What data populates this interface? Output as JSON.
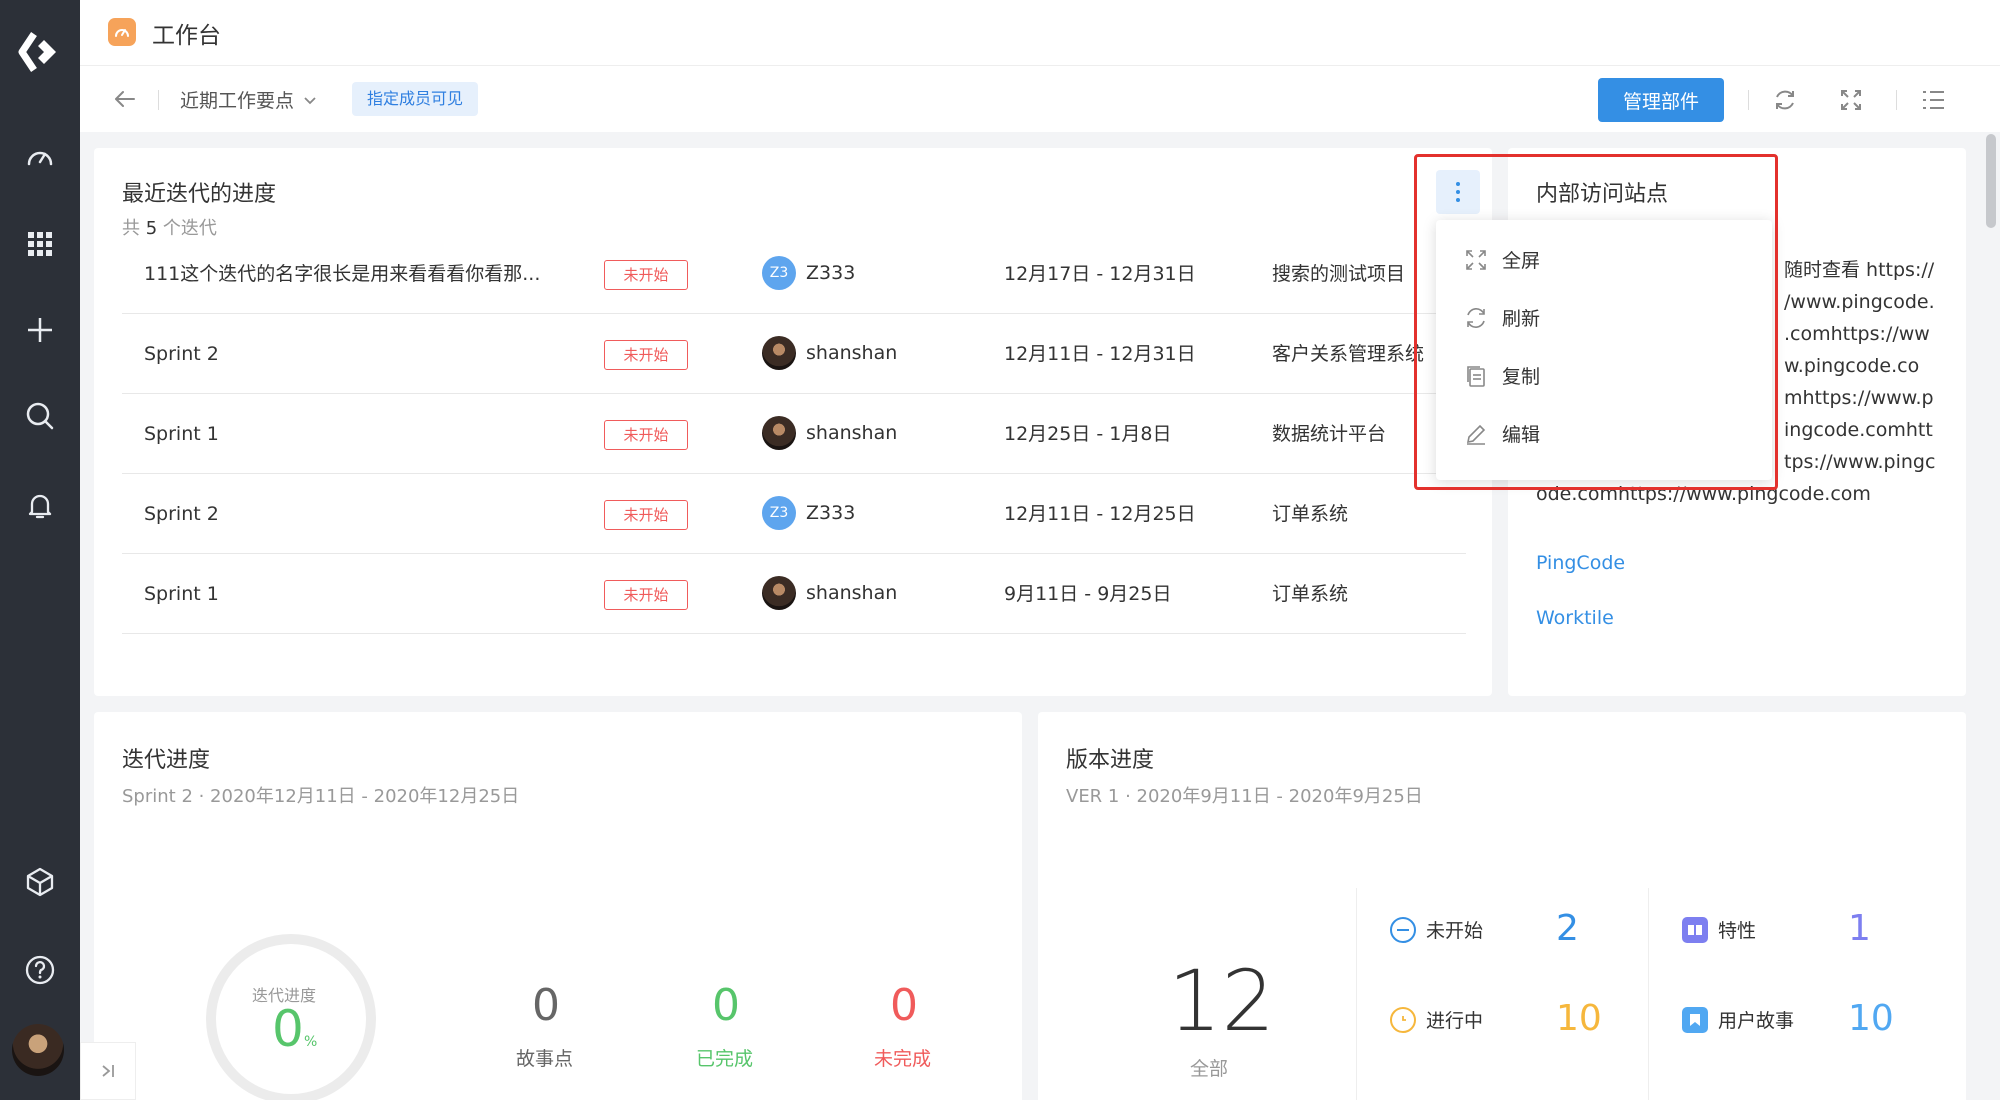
{
  "app": {
    "title": "工作台"
  },
  "toolbar": {
    "view_name": "近期工作要点",
    "visibility": "指定成员可见",
    "manage_label": "管理部件"
  },
  "iterations_card": {
    "title": "最近迭代的进度",
    "summary_prefix": "共",
    "count": "5",
    "summary_suffix": "个迭代",
    "rows": [
      {
        "name": "111这个迭代的名字很长是用来看看看你看那...",
        "status": "未开始",
        "user_initials": "Z3",
        "user": "Z333",
        "dates": "12月17日 - 12月31日",
        "project": "搜索的测试项目"
      },
      {
        "name": "Sprint 2",
        "status": "未开始",
        "user_initials": "",
        "user": "shanshan",
        "dates": "12月11日 - 12月31日",
        "project": "客户关系管理系统"
      },
      {
        "name": "Sprint 1",
        "status": "未开始",
        "user_initials": "",
        "user": "shanshan",
        "dates": "12月25日 - 1月8日",
        "project": "数据统计平台"
      },
      {
        "name": "Sprint 2",
        "status": "未开始",
        "user_initials": "Z3",
        "user": "Z333",
        "dates": "12月11日 - 12月25日",
        "project": "订单系统"
      },
      {
        "name": "Sprint 1",
        "status": "未开始",
        "user_initials": "",
        "user": "shanshan",
        "dates": "9月11日 - 9月25日",
        "project": "订单系统"
      }
    ]
  },
  "menu": {
    "items": [
      {
        "label": "全屏",
        "icon": "fullscreen-icon"
      },
      {
        "label": "刷新",
        "icon": "refresh-icon"
      },
      {
        "label": "复制",
        "icon": "copy-icon"
      },
      {
        "label": "编辑",
        "icon": "edit-icon"
      }
    ]
  },
  "sites_card": {
    "title": "内部访问站点",
    "text_lines": [
      "随时查看 https://",
      "/www.pingcode.",
      ".comhttps://ww",
      "w.pingcode.co",
      "mhttps://www.p",
      "ingcode.comhtt",
      "tps://www.pingc",
      "ode.comhttps://www.pingcode.com"
    ],
    "links": [
      "PingCode",
      "Worktile"
    ]
  },
  "iteration_progress": {
    "title": "迭代进度",
    "subtitle": "Sprint 2 · 2020年12月11日 - 2020年12月25日",
    "gauge_label": "迭代进度",
    "gauge_value": "0",
    "gauge_unit": "%",
    "stats": [
      {
        "value": "0",
        "label": "故事点",
        "color": "#666666"
      },
      {
        "value": "0",
        "label": "已完成",
        "color": "#57c56b"
      },
      {
        "value": "0",
        "label": "未完成",
        "color": "#f05b5b"
      }
    ]
  },
  "version_progress": {
    "title": "版本进度",
    "subtitle": "VER 1 · 2020年9月11日 - 2020年9月25日",
    "total": "12",
    "total_label": "全部",
    "states": [
      {
        "label": "未开始",
        "value": "2",
        "color": "#348fe4"
      },
      {
        "label": "进行中",
        "value": "10",
        "color": "#f6b73c"
      }
    ],
    "types": [
      {
        "label": "特性",
        "value": "1",
        "color": "#7d7ff0"
      },
      {
        "label": "用户故事",
        "value": "10",
        "color": "#51a8f2"
      }
    ]
  },
  "colors": {
    "accent": "#348fe4",
    "nav_bg": "#2c3038",
    "danger": "#f05b5b",
    "highlight": "#e3312d"
  }
}
